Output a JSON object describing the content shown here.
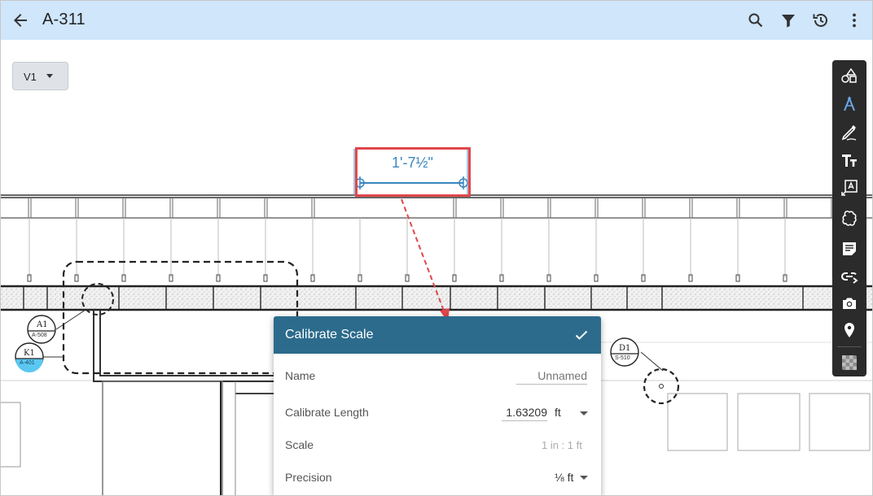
{
  "header": {
    "title": "A-311",
    "background": "#cfe6fb",
    "actions": [
      "search-icon",
      "filter-icon",
      "history-icon",
      "more-vert-icon"
    ]
  },
  "version_selector": {
    "label": "V1"
  },
  "toolbar": {
    "tools": [
      "shapes-icon",
      "measure-icon",
      "pen-icon",
      "text-icon",
      "text-box-icon",
      "cloud-icon",
      "note-icon",
      "link-icon",
      "camera-icon",
      "location-pin-icon",
      "hatch-pattern-icon"
    ],
    "active_tool": "measure-icon",
    "active_color": "#6aa8e8"
  },
  "drawing": {
    "measurement_label": "1'-7½\"",
    "highlight_color": "#e0474c",
    "measure_color": "#3b86bd",
    "callouts": [
      {
        "top": "A1",
        "bottom": "A-508"
      },
      {
        "top": "K1",
        "bottom": "A-401"
      },
      {
        "top": "D1",
        "bottom": "S-510"
      }
    ]
  },
  "dialog": {
    "title": "Calibrate Scale",
    "header_color": "#2c6b8c",
    "name_label": "Name",
    "name_placeholder": "Unnamed",
    "length_label": "Calibrate Length",
    "length_value": "1.63209",
    "length_unit": "ft",
    "scale_label": "Scale",
    "scale_value": "1 in : 1 ft",
    "precision_label": "Precision",
    "precision_value": "⅛ ft"
  }
}
